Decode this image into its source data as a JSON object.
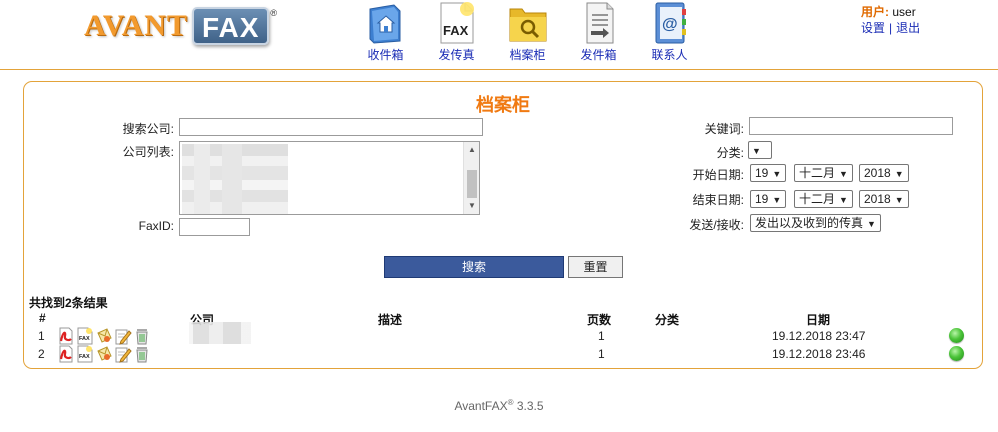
{
  "header": {
    "logo_avant": "AVANT",
    "logo_fax": "FAX",
    "logo_reg": "®",
    "nav": [
      {
        "label": "收件箱",
        "icon": "inbox-house-icon"
      },
      {
        "label": "发传真",
        "icon": "send-fax-icon"
      },
      {
        "label": "档案柜",
        "icon": "archive-folder-icon"
      },
      {
        "label": "发件箱",
        "icon": "outbox-document-icon"
      },
      {
        "label": "联系人",
        "icon": "contacts-book-icon"
      }
    ],
    "user_label": "用户:",
    "user_name": "user",
    "settings_link": "设置",
    "logout_link": "退出"
  },
  "archive": {
    "title": "档案柜",
    "search_company_label": "搜索公司:",
    "search_company_value": "",
    "company_list_label": "公司列表:",
    "faxid_label": "FaxID:",
    "faxid_value": "",
    "keyword_label": "关键词:",
    "keyword_value": "",
    "category_label": "分类:",
    "category_value": "",
    "start_date_label": "开始日期:",
    "start_day": "19",
    "start_month": "十二月",
    "start_year": "2018",
    "end_date_label": "结束日期:",
    "end_day": "19",
    "end_month": "十二月",
    "end_year": "2018",
    "direction_label": "发送/接收:",
    "direction_value": "发出以及收到的传真",
    "search_button": "搜索",
    "reset_button": "重置"
  },
  "results": {
    "count_text": "共找到2条结果",
    "columns": {
      "num": "#",
      "company": "公司",
      "description": "描述",
      "pages": "页数",
      "category": "分类",
      "date": "日期"
    },
    "rows": [
      {
        "num": "1",
        "pages": "1",
        "date": "19.12.2018 23:47",
        "status": "green"
      },
      {
        "num": "2",
        "pages": "1",
        "date": "19.12.2018 23:46",
        "status": "green"
      }
    ],
    "row_icons": [
      "pdf-icon",
      "fax-icon",
      "envelope-icon",
      "edit-icon",
      "trash-icon"
    ]
  },
  "footer": {
    "product": "AvantFAX",
    "reg": "®",
    "version": "3.3.5"
  },
  "colors": {
    "accent_orange": "#f07a12",
    "border_orange": "#e3a33a",
    "link_blue": "#1a2cb5",
    "button_blue": "#3b5a9c",
    "status_green": "#4cc43a"
  }
}
